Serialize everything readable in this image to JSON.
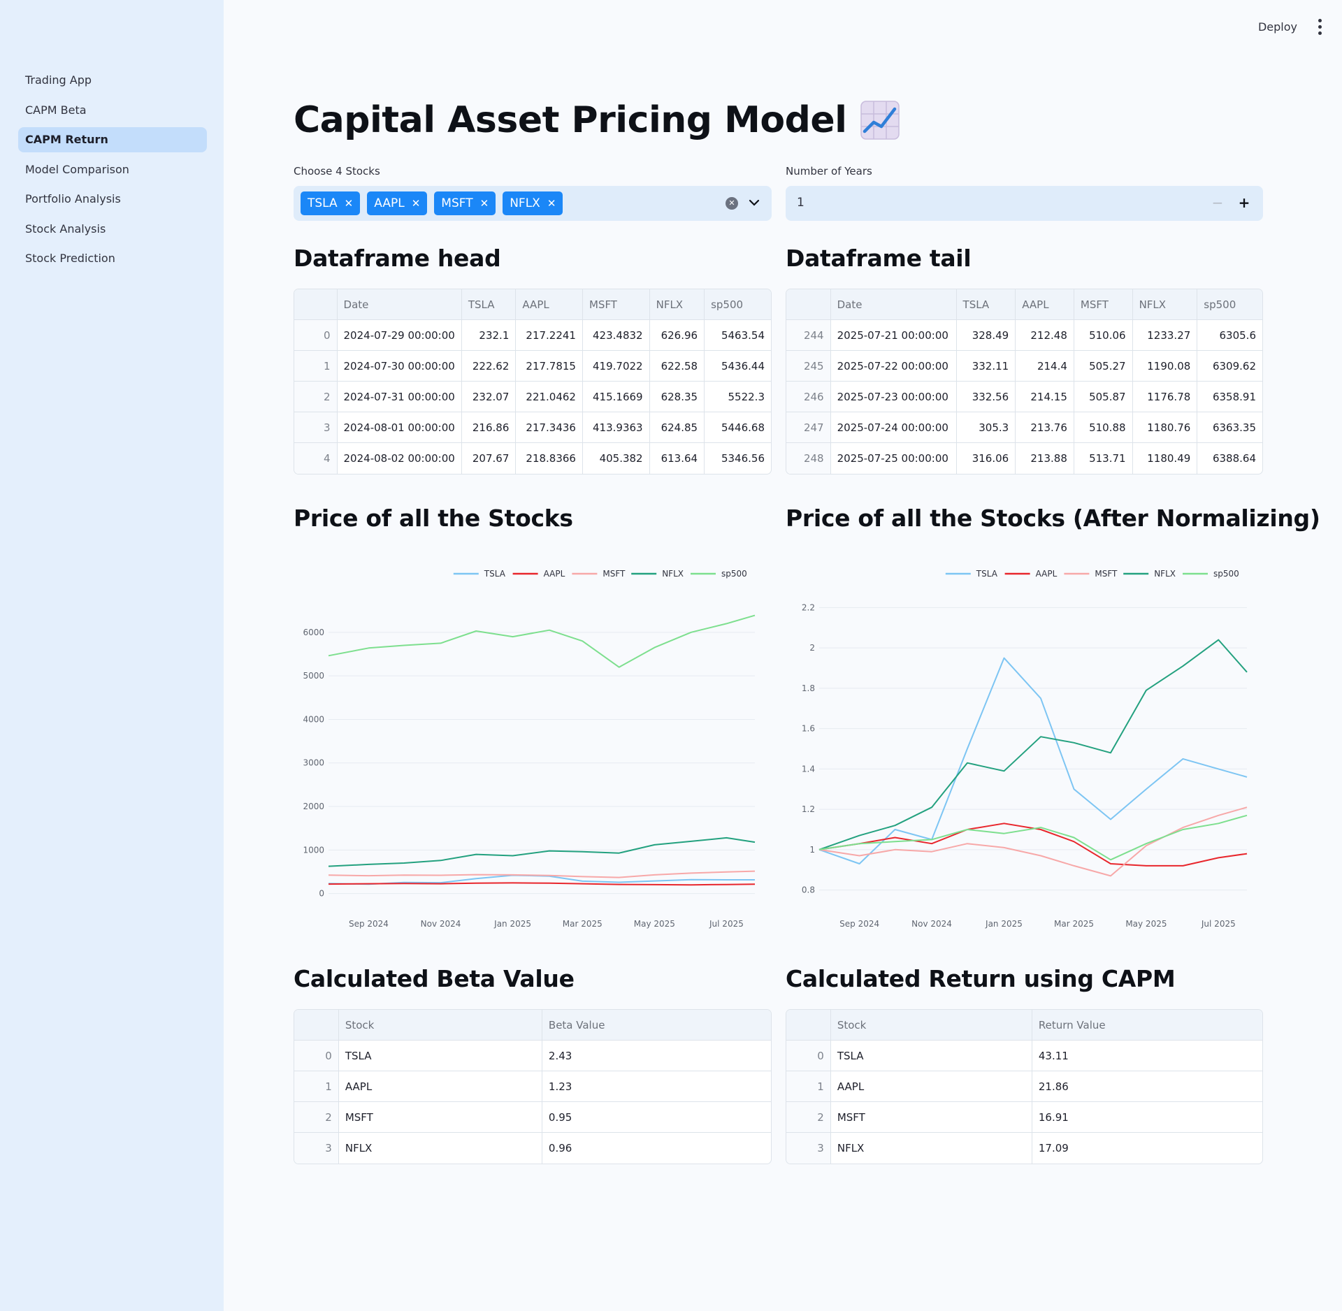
{
  "header": {
    "deploy_label": "Deploy"
  },
  "sidebar": {
    "items": [
      {
        "label": "Trading App",
        "active": false
      },
      {
        "label": "CAPM Beta",
        "active": false
      },
      {
        "label": "CAPM Return",
        "active": true
      },
      {
        "label": "Model Comparison",
        "active": false
      },
      {
        "label": "Portfolio Analysis",
        "active": false
      },
      {
        "label": "Stock Analysis",
        "active": false
      },
      {
        "label": "Stock Prediction",
        "active": false
      }
    ]
  },
  "page": {
    "title": "Capital Asset Pricing Model",
    "title_icon": "chart-increasing-icon"
  },
  "controls": {
    "stocks_label": "Choose 4 Stocks",
    "stocks_selected": [
      "TSLA",
      "AAPL",
      "MSFT",
      "NFLX"
    ],
    "years_label": "Number of Years",
    "years_value": "1"
  },
  "sections": {
    "head": "Dataframe head",
    "tail": "Dataframe tail",
    "price": "Price of all the Stocks",
    "price_norm": "Price of all the Stocks (After Normalizing)",
    "beta": "Calculated Beta Value",
    "capm": "Calculated Return using CAPM"
  },
  "df_head": {
    "columns": [
      "",
      "Date",
      "TSLA",
      "AAPL",
      "MSFT",
      "NFLX",
      "sp500"
    ],
    "rows": [
      [
        "0",
        "2024-07-29 00:00:00",
        "232.1",
        "217.2241",
        "423.4832",
        "626.96",
        "5463.54"
      ],
      [
        "1",
        "2024-07-30 00:00:00",
        "222.62",
        "217.7815",
        "419.7022",
        "622.58",
        "5436.44"
      ],
      [
        "2",
        "2024-07-31 00:00:00",
        "232.07",
        "221.0462",
        "415.1669",
        "628.35",
        "5522.3"
      ],
      [
        "3",
        "2024-08-01 00:00:00",
        "216.86",
        "217.3436",
        "413.9363",
        "624.85",
        "5446.68"
      ],
      [
        "4",
        "2024-08-02 00:00:00",
        "207.67",
        "218.8366",
        "405.382",
        "613.64",
        "5346.56"
      ]
    ]
  },
  "df_tail": {
    "columns": [
      "",
      "Date",
      "TSLA",
      "AAPL",
      "MSFT",
      "NFLX",
      "sp500"
    ],
    "rows": [
      [
        "244",
        "2025-07-21 00:00:00",
        "328.49",
        "212.48",
        "510.06",
        "1233.27",
        "6305.6"
      ],
      [
        "245",
        "2025-07-22 00:00:00",
        "332.11",
        "214.4",
        "505.27",
        "1190.08",
        "6309.62"
      ],
      [
        "246",
        "2025-07-23 00:00:00",
        "332.56",
        "214.15",
        "505.87",
        "1176.78",
        "6358.91"
      ],
      [
        "247",
        "2025-07-24 00:00:00",
        "305.3",
        "213.76",
        "510.88",
        "1180.76",
        "6363.35"
      ],
      [
        "248",
        "2025-07-25 00:00:00",
        "316.06",
        "213.88",
        "513.71",
        "1180.49",
        "6388.64"
      ]
    ]
  },
  "beta_table": {
    "columns": [
      "",
      "Stock",
      "Beta Value"
    ],
    "rows": [
      [
        "0",
        "TSLA",
        "2.43"
      ],
      [
        "1",
        "AAPL",
        "1.23"
      ],
      [
        "2",
        "MSFT",
        "0.95"
      ],
      [
        "3",
        "NFLX",
        "0.96"
      ]
    ]
  },
  "return_table": {
    "columns": [
      "",
      "Stock",
      "Return Value"
    ],
    "rows": [
      [
        "0",
        "TSLA",
        "43.11"
      ],
      [
        "1",
        "AAPL",
        "21.86"
      ],
      [
        "2",
        "MSFT",
        "16.91"
      ],
      [
        "3",
        "NFLX",
        "17.09"
      ]
    ]
  },
  "chart_data": [
    {
      "type": "line",
      "x": [
        "2024-07-29",
        "2024-09-01",
        "2024-10-01",
        "2024-11-01",
        "2024-12-01",
        "2025-01-01",
        "2025-02-01",
        "2025-03-01",
        "2025-04-01",
        "2025-05-01",
        "2025-06-01",
        "2025-07-01",
        "2025-07-25"
      ],
      "x_ticks": [
        "Sep 2024",
        "Nov 2024",
        "Jan 2025",
        "Mar 2025",
        "May 2025",
        "Jul 2025"
      ],
      "x_tick_dates": [
        "2024-09-01",
        "2024-11-01",
        "2025-01-01",
        "2025-03-01",
        "2025-05-01",
        "2025-07-01"
      ],
      "xlim": [
        "2024-07-29",
        "2025-07-25"
      ],
      "y_ticks": [
        0,
        1000,
        2000,
        3000,
        4000,
        5000,
        6000
      ],
      "ylim": [
        -150,
        6800
      ],
      "grid": true,
      "legend_position": "top-right",
      "series": [
        {
          "name": "TSLA",
          "color": "#7dc5f3",
          "values": [
            232,
            215,
            255,
            250,
            345,
            420,
            400,
            285,
            260,
            290,
            320,
            315,
            316
          ]
        },
        {
          "name": "AAPL",
          "color": "#e8262c",
          "values": [
            217,
            225,
            230,
            225,
            238,
            245,
            240,
            225,
            210,
            205,
            200,
            208,
            214
          ]
        },
        {
          "name": "MSFT",
          "color": "#f7a8a8",
          "values": [
            423,
            410,
            425,
            420,
            435,
            430,
            415,
            390,
            370,
            430,
            470,
            495,
            514
          ]
        },
        {
          "name": "NFLX",
          "color": "#23a17f",
          "values": [
            627,
            670,
            700,
            760,
            900,
            870,
            980,
            960,
            930,
            1120,
            1200,
            1280,
            1180
          ]
        },
        {
          "name": "sp500",
          "color": "#7ddf8e",
          "values": [
            5463,
            5640,
            5700,
            5750,
            6030,
            5900,
            6050,
            5800,
            5200,
            5650,
            6000,
            6200,
            6389
          ]
        }
      ]
    },
    {
      "type": "line",
      "x": [
        "2024-07-29",
        "2024-09-01",
        "2024-10-01",
        "2024-11-01",
        "2024-12-01",
        "2025-01-01",
        "2025-02-01",
        "2025-03-01",
        "2025-04-01",
        "2025-05-01",
        "2025-06-01",
        "2025-07-01",
        "2025-07-25"
      ],
      "x_ticks": [
        "Sep 2024",
        "Nov 2024",
        "Jan 2025",
        "Mar 2025",
        "May 2025",
        "Jul 2025"
      ],
      "x_tick_dates": [
        "2024-09-01",
        "2024-11-01",
        "2025-01-01",
        "2025-03-01",
        "2025-05-01",
        "2025-07-01"
      ],
      "xlim": [
        "2024-07-29",
        "2025-07-25"
      ],
      "y_ticks": [
        0.8,
        1,
        1.2,
        1.4,
        1.6,
        1.8,
        2,
        2.2
      ],
      "ylim": [
        0.75,
        2.25
      ],
      "grid": true,
      "legend_position": "top-right",
      "series": [
        {
          "name": "TSLA",
          "color": "#7dc5f3",
          "values": [
            1.0,
            0.93,
            1.1,
            1.05,
            1.5,
            1.95,
            1.75,
            1.3,
            1.15,
            1.3,
            1.45,
            1.4,
            1.36
          ]
        },
        {
          "name": "AAPL",
          "color": "#e8262c",
          "values": [
            1.0,
            1.03,
            1.06,
            1.03,
            1.1,
            1.13,
            1.1,
            1.04,
            0.93,
            0.92,
            0.92,
            0.96,
            0.98
          ]
        },
        {
          "name": "MSFT",
          "color": "#f7a8a8",
          "values": [
            1.0,
            0.97,
            1.0,
            0.99,
            1.03,
            1.01,
            0.97,
            0.92,
            0.87,
            1.02,
            1.11,
            1.17,
            1.21
          ]
        },
        {
          "name": "NFLX",
          "color": "#23a17f",
          "values": [
            1.0,
            1.07,
            1.12,
            1.21,
            1.43,
            1.39,
            1.56,
            1.53,
            1.48,
            1.79,
            1.91,
            2.04,
            1.88
          ]
        },
        {
          "name": "sp500",
          "color": "#7ddf8e",
          "values": [
            1.0,
            1.03,
            1.04,
            1.05,
            1.1,
            1.08,
            1.11,
            1.06,
            0.95,
            1.03,
            1.1,
            1.13,
            1.17
          ]
        }
      ]
    }
  ]
}
